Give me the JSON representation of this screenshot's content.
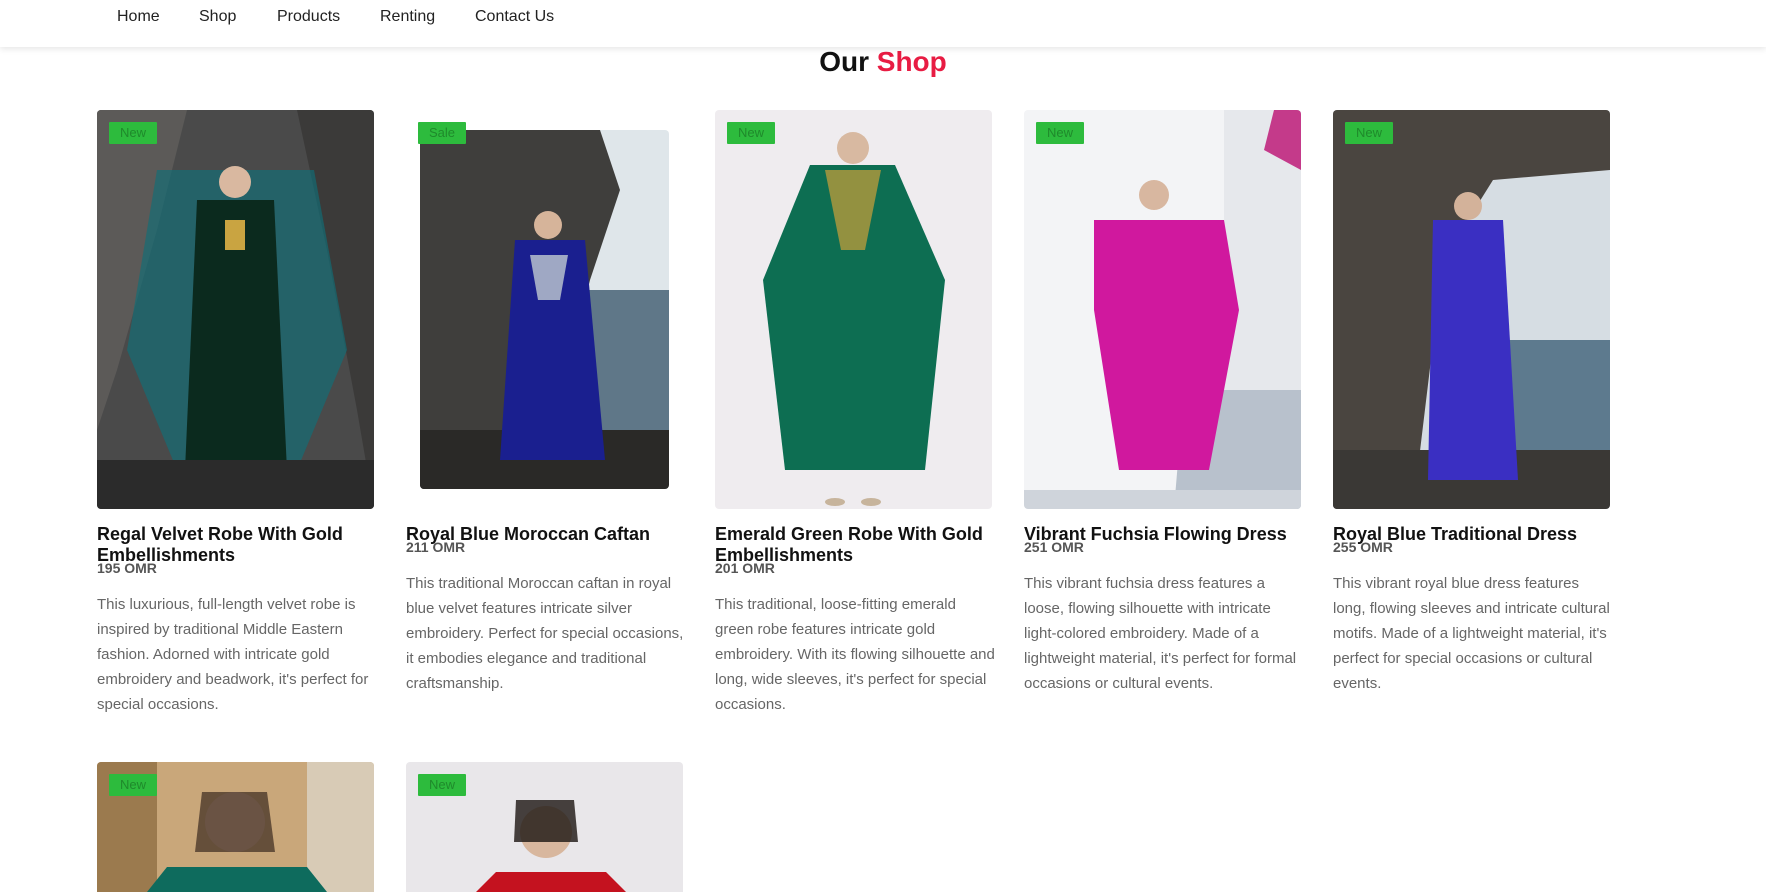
{
  "nav": {
    "items": [
      "Home",
      "Shop",
      "Products",
      "Renting",
      "Contact Us"
    ]
  },
  "section": {
    "title_prefix": "Our",
    "title_accent": "Shop"
  },
  "colors": {
    "accent": "#e81c43",
    "badge": "#2dbb3d"
  },
  "products": [
    {
      "badge": "New",
      "name": "Regal Velvet Robe With Gold Embellishments",
      "price": "195 OMR",
      "description": "This luxurious, full-length velvet robe is inspired by traditional Middle Eastern fashion. Adorned with intricate gold embroidery and beadwork, it's perfect for special occasions."
    },
    {
      "badge": "Sale",
      "name": "Royal Blue Moroccan Caftan",
      "price": "211 OMR",
      "description": "This traditional Moroccan caftan in royal blue velvet features intricate silver embroidery. Perfect for special occasions, it embodies elegance and traditional craftsmanship."
    },
    {
      "badge": "New",
      "name": "Emerald Green Robe With Gold Embellishments",
      "price": "201 OMR",
      "description": "This traditional, loose-fitting emerald green robe features intricate gold embroidery. With its flowing silhouette and long, wide sleeves, it's perfect for special occasions."
    },
    {
      "badge": "New",
      "name": "Vibrant Fuchsia Flowing Dress",
      "price": "251 OMR",
      "description": "This vibrant fuchsia dress features a loose, flowing silhouette with intricate light-colored embroidery. Made of a lightweight material, it's perfect for formal occasions or cultural events."
    },
    {
      "badge": "New",
      "name": "Royal Blue Traditional Dress",
      "price": "255 OMR",
      "description": "This vibrant royal blue dress features long, flowing sleeves and intricate cultural motifs. Made of a lightweight material, it's perfect for special occasions or cultural events."
    },
    {
      "badge": "New"
    },
    {
      "badge": "New"
    }
  ]
}
